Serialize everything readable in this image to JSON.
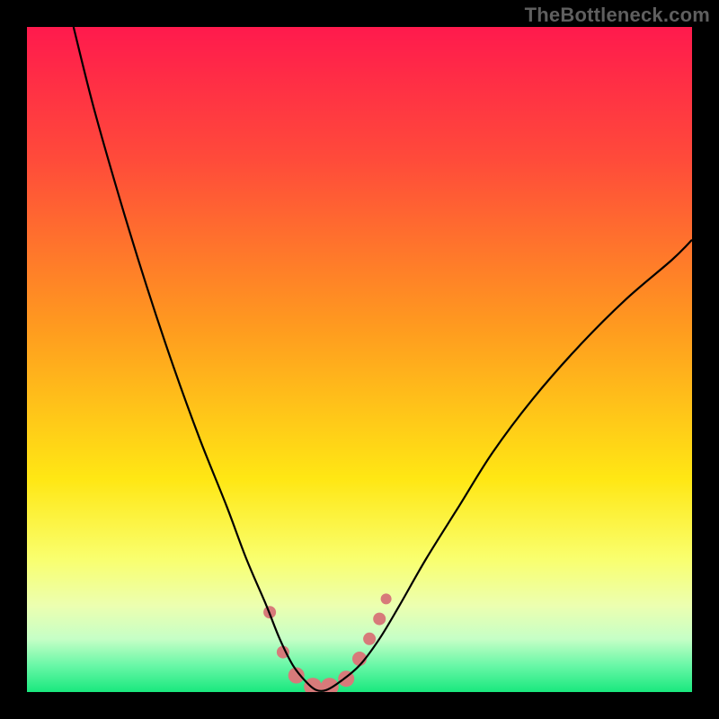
{
  "watermark": "TheBottleneck.com",
  "chart_data": {
    "type": "line",
    "title": "",
    "xlabel": "",
    "ylabel": "",
    "xlim": [
      0,
      100
    ],
    "ylim": [
      0,
      100
    ],
    "gradient_stops": [
      {
        "offset": 0.0,
        "color": "#ff1a4d"
      },
      {
        "offset": 0.2,
        "color": "#ff4b3a"
      },
      {
        "offset": 0.45,
        "color": "#ff9a1f"
      },
      {
        "offset": 0.68,
        "color": "#ffe714"
      },
      {
        "offset": 0.8,
        "color": "#f9ff6e"
      },
      {
        "offset": 0.87,
        "color": "#ecffb0"
      },
      {
        "offset": 0.92,
        "color": "#c6ffc6"
      },
      {
        "offset": 0.96,
        "color": "#69f7a7"
      },
      {
        "offset": 1.0,
        "color": "#19e87e"
      }
    ],
    "series": [
      {
        "name": "bottleneck-curve",
        "x": [
          7,
          10,
          14,
          18,
          22,
          26,
          30,
          33,
          36,
          38,
          40,
          42,
          43.5,
          45,
          47,
          50,
          53,
          56,
          60,
          65,
          70,
          76,
          83,
          90,
          97,
          100
        ],
        "y": [
          100,
          88,
          74,
          61,
          49,
          38,
          28,
          20,
          13,
          8,
          4,
          1.5,
          0.3,
          0.3,
          1.5,
          4,
          8,
          13,
          20,
          28,
          36,
          44,
          52,
          59,
          65,
          68
        ]
      }
    ],
    "highlight_points": {
      "name": "highlight-dots",
      "color": "#d77a7a",
      "points": [
        {
          "x": 36.5,
          "y": 12,
          "r": 7
        },
        {
          "x": 38.5,
          "y": 6,
          "r": 7
        },
        {
          "x": 40.5,
          "y": 2.5,
          "r": 9
        },
        {
          "x": 43,
          "y": 0.8,
          "r": 10
        },
        {
          "x": 45.5,
          "y": 0.8,
          "r": 10
        },
        {
          "x": 48,
          "y": 2,
          "r": 9
        },
        {
          "x": 50,
          "y": 5,
          "r": 8
        },
        {
          "x": 51.5,
          "y": 8,
          "r": 7
        },
        {
          "x": 53,
          "y": 11,
          "r": 7
        },
        {
          "x": 54,
          "y": 14,
          "r": 6
        }
      ]
    }
  }
}
